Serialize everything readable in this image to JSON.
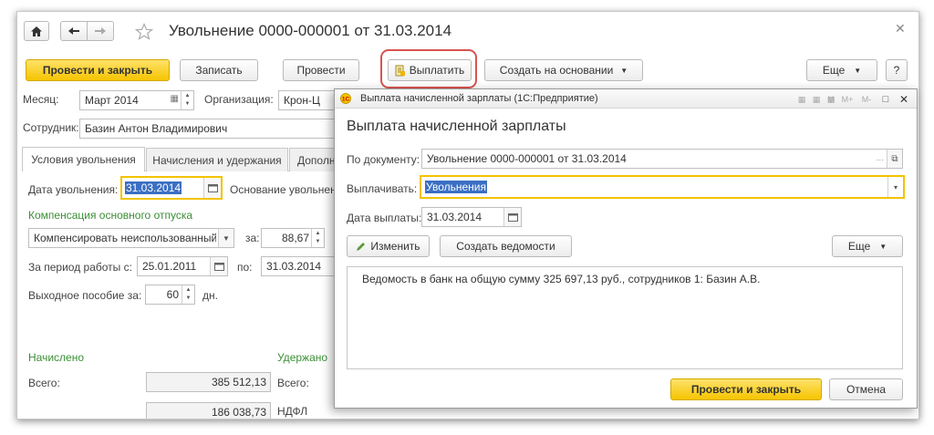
{
  "main": {
    "title": "Увольнение 0000-000001 от 31.03.2014",
    "toolbar": {
      "post_close": "Провести и закрыть",
      "save": "Записать",
      "post": "Провести",
      "pay": "Выплатить",
      "create_based_on": "Создать на основании",
      "more": "Еще",
      "help": "?"
    },
    "month_label": "Месяц:",
    "month_value": "Март 2014",
    "org_label": "Организация:",
    "org_value": "Крон-Ц",
    "employee_label": "Сотрудник:",
    "employee_value": "Базин Антон Владимирович",
    "tabs": [
      "Условия увольнения",
      "Начисления и удержания",
      "Дополнительно"
    ],
    "dismissal_date_label": "Дата увольнения:",
    "dismissal_date_value": "31.03.2014",
    "reason_label": "Основание увольнения",
    "compensation_title": "Компенсация основного отпуска",
    "compensation_value": "Компенсировать неиспользованный отпуск",
    "for_label": "за:",
    "for_value": "88,67",
    "period_label": "За период работы с:",
    "period_from": "25.01.2011",
    "period_to_label": "по:",
    "period_to": "31.03.2014",
    "severance_label": "Выходное пособие за:",
    "severance_value": "60",
    "days_label": "дн.",
    "accrued_title": "Начислено",
    "withheld_title": "Удержано",
    "total_label": "Всего:",
    "total_value": "385 512,13",
    "total_label2": "Всего:",
    "cut_row_value": "186 038,73",
    "cut_row_label": "НДФЛ"
  },
  "dialog": {
    "window_title": "Выплата начисленной зарплаты (1С:Предприятие)",
    "tb_icons": [
      "M",
      "M+",
      "M-"
    ],
    "heading": "Выплата начисленной зарплаты",
    "doc_label": "По документу:",
    "doc_value": "Увольнение 0000-000001 от 31.03.2014",
    "pay_label": "Выплачивать:",
    "pay_value": "Увольнения",
    "date_label": "Дата выплаты:",
    "date_value": "31.03.2014",
    "edit": "Изменить",
    "create_statement": "Создать ведомости",
    "more": "Еще",
    "statement_text": "Ведомость в банк на общую сумму 325 697,13 руб., сотрудников 1: Базин А.В.",
    "post_close": "Провести и закрыть",
    "cancel": "Отмена"
  },
  "colors": {
    "accent_yellow": "#f5c400",
    "highlight_red": "#d9534f",
    "green_text": "#3a8f35",
    "selection_blue": "#3b6fc4"
  }
}
